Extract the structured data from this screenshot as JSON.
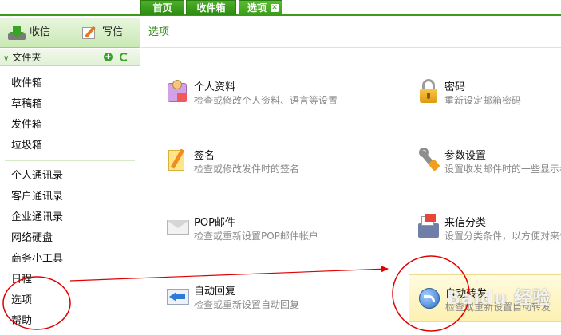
{
  "tabs": [
    {
      "label": "首页"
    },
    {
      "label": "收件箱"
    },
    {
      "label": "选项",
      "close": "✕"
    }
  ],
  "toolbar": {
    "receive_label": "收信",
    "write_label": "写信"
  },
  "folders": {
    "header": "文件夹",
    "items": [
      "收件箱",
      "草稿箱",
      "发件箱",
      "垃圾箱"
    ]
  },
  "tools": {
    "items": [
      "个人通讯录",
      "客户通讯录",
      "企业通讯录",
      "网络硬盘",
      "商务小工具",
      "日程",
      "选项",
      "帮助"
    ]
  },
  "content": {
    "title": "选项",
    "options": [
      {
        "title": "个人资料",
        "desc": "检查或修改个人资料、语言等设置",
        "icon": "profile-icon"
      },
      {
        "title": "密码",
        "desc": "重新设定邮箱密码",
        "icon": "lock-icon"
      },
      {
        "title": "签名",
        "desc": "检查或修改发件时的签名",
        "icon": "signature-icon"
      },
      {
        "title": "参数设置",
        "desc": "设置收发邮件时的一些显示参",
        "icon": "wrench-icon"
      },
      {
        "title": "POP邮件",
        "desc": "检查或重新设置POP邮件帐户",
        "icon": "envelope-icon"
      },
      {
        "title": "来信分类",
        "desc": "设置分类条件，以方便对来信",
        "icon": "filter-icon"
      },
      {
        "title": "自动回复",
        "desc": "检查或重新设置自动回复",
        "icon": "reply-icon"
      },
      {
        "title": "自动转发",
        "desc": "检查或重新设置自动转发",
        "icon": "forward-icon"
      }
    ]
  },
  "watermark": "Baidu 经验",
  "colors": {
    "brand": "#2d8a12",
    "annotation": "#e00000"
  }
}
